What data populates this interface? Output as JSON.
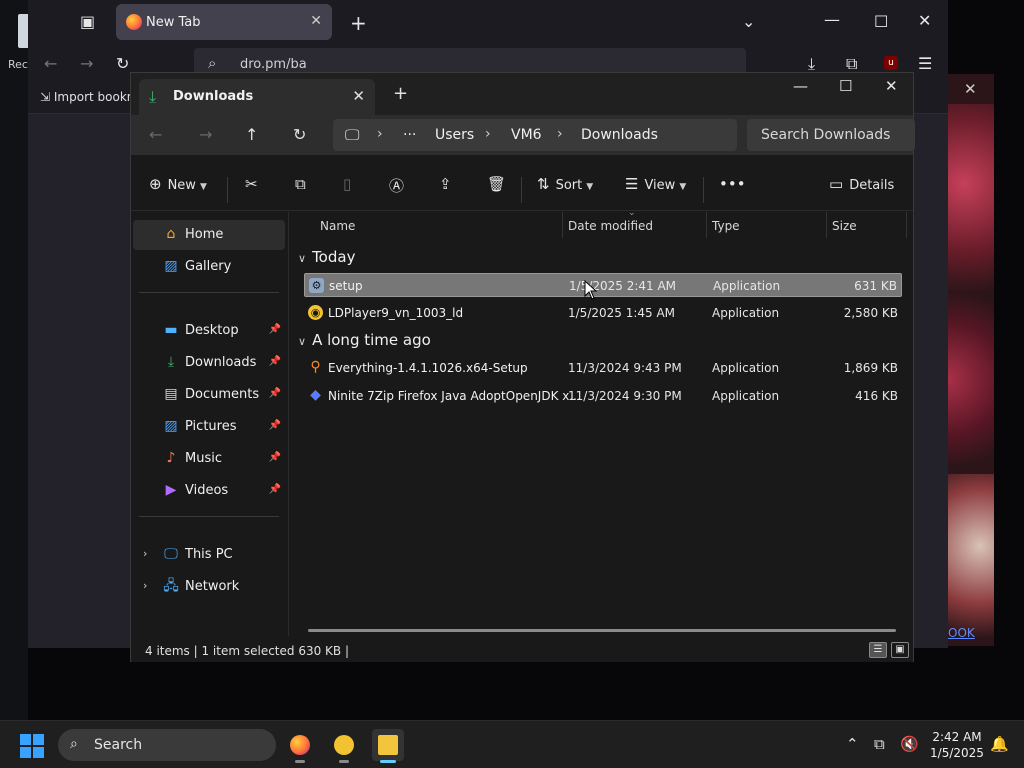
{
  "desktop": {
    "label": "Rec"
  },
  "firefox": {
    "tab_title": "New Tab",
    "url": "dro.pm/ba",
    "import_bookmarks": "Import bookm"
  },
  "background_window": {
    "link_text": "OOK"
  },
  "explorer": {
    "tab_title": "Downloads",
    "breadcrumb": [
      "Users",
      "VM6",
      "Downloads"
    ],
    "search_placeholder": "Search Downloads",
    "commands": {
      "new": "New",
      "sort": "Sort",
      "view": "View",
      "details": "Details"
    },
    "nav": {
      "home": "Home",
      "gallery": "Gallery",
      "desktop": "Desktop",
      "downloads": "Downloads",
      "documents": "Documents",
      "pictures": "Pictures",
      "music": "Music",
      "videos": "Videos",
      "this_pc": "This PC",
      "network": "Network"
    },
    "columns": {
      "name": "Name",
      "date": "Date modified",
      "type": "Type",
      "size": "Size"
    },
    "groups": [
      {
        "label": "Today",
        "files": [
          {
            "name": "setup",
            "date": "1/5/2025 2:41 AM",
            "type": "Application",
            "size": "631 KB",
            "selected": true,
            "icon": "installer-icon",
            "color": "#8fa8c8"
          },
          {
            "name": "LDPlayer9_vn_1003_ld",
            "date": "1/5/2025 1:45 AM",
            "type": "Application",
            "size": "2,580 KB",
            "selected": false,
            "icon": "ldplayer-icon",
            "color": "#f2c230"
          }
        ]
      },
      {
        "label": "A long time ago",
        "files": [
          {
            "name": "Everything-1.4.1.1026.x64-Setup",
            "date": "11/3/2024 9:43 PM",
            "type": "Application",
            "size": "1,869 KB",
            "selected": false,
            "icon": "everything-search-icon",
            "color": "#ff8a1f"
          },
          {
            "name": "Ninite 7Zip Firefox Java AdoptOpenJDK x...",
            "date": "11/3/2024 9:30 PM",
            "type": "Application",
            "size": "416 KB",
            "selected": false,
            "icon": "ninite-icon",
            "color": "#5b7cff"
          }
        ]
      }
    ],
    "status": {
      "count": "4 items",
      "selected": "1 item selected  630 KB"
    }
  },
  "taskbar": {
    "search_placeholder": "Search",
    "time": "2:42 AM",
    "date": "1/5/2025"
  },
  "colors": {
    "accent": "#60cdff",
    "selection": "#777777",
    "start": "#37a2ff"
  }
}
